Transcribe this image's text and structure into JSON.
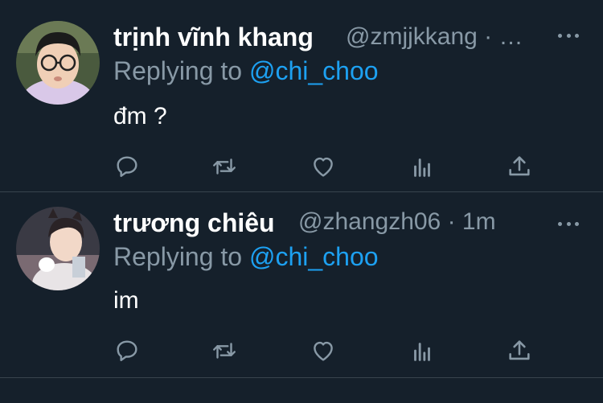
{
  "tweets": [
    {
      "name": "trịnh vĩnh khang",
      "handle": "@zmjjkkang · …",
      "replying_prefix": "Replying to",
      "replying_handle": "@chi_choo",
      "text": "đm ?"
    },
    {
      "name": "trương chiêu",
      "handle": "@zhangzh06 · 1m",
      "replying_prefix": "Replying to",
      "replying_handle": "@chi_choo",
      "text": "im"
    }
  ],
  "icons": [
    "reply-icon",
    "retweet-icon",
    "like-icon",
    "analytics-icon",
    "share-icon",
    "more-icon"
  ],
  "colors": {
    "background": "#15202b",
    "secondary_text": "#8899a6",
    "mention": "#1da1f2",
    "divider": "#38444d"
  }
}
